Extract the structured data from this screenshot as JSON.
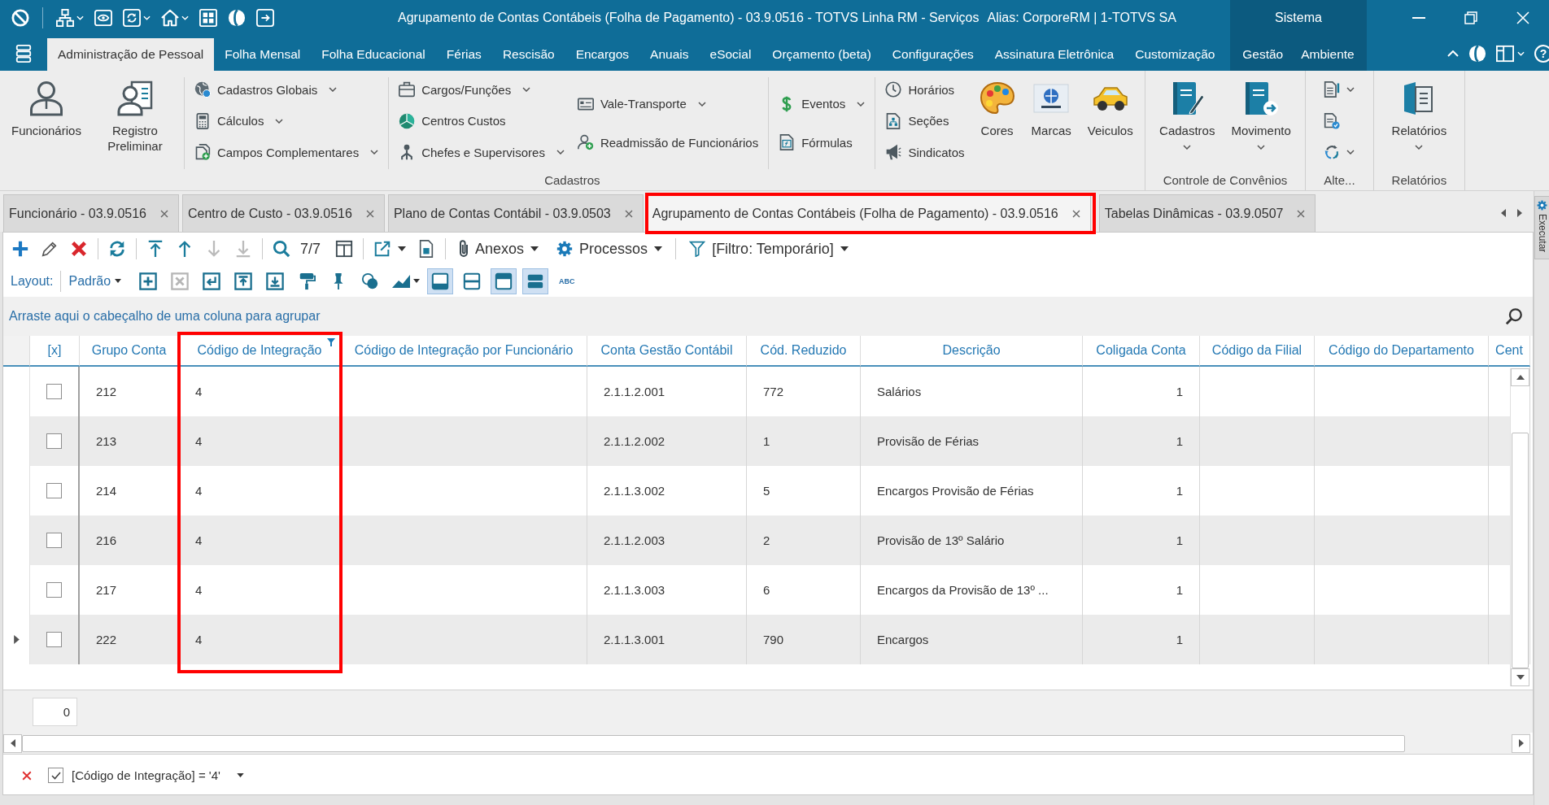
{
  "window": {
    "title": "Agrupamento de Contas Contábeis (Folha de Pagamento) - 03.9.0516 - TOTVS Linha RM - Serviços",
    "alias": "Alias: CorporeRM | 1-TOTVS SA",
    "context_group": "Sistema"
  },
  "menu": {
    "tabs": [
      {
        "label": "Administração de Pessoal",
        "selected": true
      },
      {
        "label": "Folha Mensal",
        "selected": false
      },
      {
        "label": "Folha Educacional",
        "selected": false
      },
      {
        "label": "Férias",
        "selected": false
      },
      {
        "label": "Rescisão",
        "selected": false
      },
      {
        "label": "Encargos",
        "selected": false
      },
      {
        "label": "Anuais",
        "selected": false
      },
      {
        "label": "eSocial",
        "selected": false
      },
      {
        "label": "Orçamento (beta)",
        "selected": false
      },
      {
        "label": "Configurações",
        "selected": false
      },
      {
        "label": "Assinatura Eletrônica",
        "selected": false
      },
      {
        "label": "Customização",
        "selected": false
      }
    ],
    "context_tabs": [
      {
        "label": "Gestão",
        "selected": false
      },
      {
        "label": "Ambiente",
        "selected": false
      }
    ],
    "help": "?"
  },
  "ribbon": {
    "groups": [
      {
        "label": "Cadastros",
        "sections": [
          {
            "blocks": [
              {
                "kind": "large",
                "items": [
                  {
                    "label": "Funcionários",
                    "dropdown": false
                  },
                  {
                    "label": "Registro Preliminar",
                    "dropdown": false
                  }
                ]
              }
            ]
          },
          {
            "blocks": [
              {
                "kind": "column",
                "items": [
                  {
                    "label": "Cadastros Globais",
                    "dropdown": true
                  },
                  {
                    "label": "Cálculos",
                    "dropdown": true
                  },
                  {
                    "label": "Campos Complementares",
                    "dropdown": true
                  }
                ]
              }
            ]
          },
          {
            "blocks": [
              {
                "kind": "column",
                "items": [
                  {
                    "label": "Cargos/Funções",
                    "dropdown": true
                  },
                  {
                    "label": "Centros Custos",
                    "dropdown": false
                  },
                  {
                    "label": "Chefes e Supervisores",
                    "dropdown": true
                  }
                ]
              },
              {
                "kind": "column",
                "items": [
                  {
                    "label": "Vale-Transporte",
                    "dropdown": true
                  },
                  {
                    "label": "Readmissão de Funcionários",
                    "dropdown": false
                  }
                ]
              }
            ]
          },
          {
            "blocks": [
              {
                "kind": "column",
                "items": [
                  {
                    "label": "Eventos",
                    "dropdown": true
                  },
                  {
                    "label": "Fórmulas",
                    "dropdown": false
                  }
                ]
              }
            ]
          },
          {
            "blocks": [
              {
                "kind": "column",
                "items": [
                  {
                    "label": "Horários",
                    "dropdown": false
                  },
                  {
                    "label": "Seções",
                    "dropdown": false
                  },
                  {
                    "label": "Sindicatos",
                    "dropdown": false
                  }
                ]
              },
              {
                "kind": "large",
                "items": [
                  {
                    "label": "Cores",
                    "dropdown": false
                  },
                  {
                    "label": "Marcas",
                    "dropdown": false
                  },
                  {
                    "label": "Veiculos",
                    "dropdown": false
                  }
                ]
              }
            ]
          }
        ]
      },
      {
        "label": "Controle de Convênios",
        "sections": [
          {
            "blocks": [
              {
                "kind": "large",
                "items": [
                  {
                    "label": "Cadastros",
                    "dropdown": true
                  },
                  {
                    "label": "Movimento",
                    "dropdown": true
                  }
                ]
              }
            ]
          }
        ]
      },
      {
        "label": "Alte...",
        "sections": [
          {
            "blocks": [
              {
                "kind": "icons",
                "items": [
                  {
                    "dropdown": true
                  },
                  {
                    "dropdown": false
                  },
                  {
                    "dropdown": true
                  }
                ]
              }
            ]
          }
        ]
      },
      {
        "label": "Relatórios",
        "sections": [
          {
            "blocks": [
              {
                "kind": "large",
                "items": [
                  {
                    "label": "Relatórios",
                    "dropdown": true
                  }
                ]
              }
            ]
          }
        ]
      }
    ]
  },
  "documents": {
    "tabs": [
      {
        "label": "Funcionário - 03.9.0516",
        "selected": false,
        "highlighted": false
      },
      {
        "label": "Centro de Custo - 03.9.0516",
        "selected": false,
        "highlighted": false
      },
      {
        "label": "Plano de Contas Contábil - 03.9.0503",
        "selected": false,
        "highlighted": false
      },
      {
        "label": "Agrupamento de Contas Contábeis (Folha de Pagamento) - 03.9.0516",
        "selected": true,
        "highlighted": true
      },
      {
        "label": "Tabelas Dinâmicas - 03.9.0507",
        "selected": false,
        "highlighted": false
      }
    ]
  },
  "toolbar": {
    "groups": [
      {
        "items": [
          {
            "kind": "button",
            "disabled": false
          },
          {
            "kind": "button",
            "disabled": false
          },
          {
            "kind": "button",
            "disabled": false
          }
        ]
      },
      {
        "items": [
          {
            "kind": "button",
            "disabled": false
          }
        ]
      },
      {
        "items": [
          {
            "kind": "button",
            "disabled": false
          },
          {
            "kind": "button",
            "disabled": false
          },
          {
            "kind": "button",
            "disabled": true
          },
          {
            "kind": "button",
            "disabled": true
          }
        ]
      },
      {
        "items": [
          {
            "kind": "button",
            "disabled": false
          },
          {
            "kind": "text",
            "label": "7/7"
          },
          {
            "kind": "button",
            "disabled": false
          }
        ]
      },
      {
        "items": [
          {
            "kind": "dropdown",
            "disabled": false
          },
          {
            "kind": "button",
            "disabled": false
          }
        ]
      },
      {
        "items": [
          {
            "kind": "menu",
            "label": "Anexos",
            "disabled": false
          },
          {
            "kind": "menu",
            "label": "Processos",
            "disabled": false
          }
        ]
      },
      {
        "items": [
          {
            "kind": "menu",
            "label": "[Filtro: Temporário]",
            "disabled": false
          }
        ]
      }
    ]
  },
  "layout_bar": {
    "label": "Layout:",
    "menu": "Padrão",
    "items": [
      {
        "kind": "button",
        "disabled": false
      },
      {
        "kind": "button",
        "disabled": true
      },
      {
        "kind": "button",
        "disabled": false
      },
      {
        "kind": "button",
        "disabled": false
      },
      {
        "kind": "button",
        "disabled": false
      },
      {
        "kind": "button",
        "disabled": false
      },
      {
        "kind": "button",
        "disabled": false
      },
      {
        "kind": "button",
        "disabled": false
      },
      {
        "kind": "dropdown",
        "disabled": false
      },
      {
        "kind": "toggle",
        "pressed": true
      },
      {
        "kind": "toggle",
        "pressed": false
      },
      {
        "kind": "toggle",
        "pressed": true
      },
      {
        "kind": "toggle",
        "pressed": true
      },
      {
        "kind": "text",
        "label": "ABC"
      }
    ]
  },
  "table": {
    "group_hint": "Arraste aqui o cabeçalho de uma coluna para agrupar",
    "columns": [
      {
        "label": "[x]",
        "kind": "check",
        "filtered": false,
        "highlighted": false
      },
      {
        "label": "Grupo Conta",
        "kind": "text",
        "filtered": false,
        "highlighted": false
      },
      {
        "label": "Código de Integração",
        "kind": "text",
        "filtered": true,
        "highlighted": true
      },
      {
        "label": "Código de Integração por Funcionário",
        "kind": "text",
        "filtered": false,
        "highlighted": false
      },
      {
        "label": "Conta Gestão Contábil",
        "kind": "text",
        "filtered": false,
        "highlighted": false
      },
      {
        "label": "Cód. Reduzido",
        "kind": "text",
        "filtered": false,
        "highlighted": false
      },
      {
        "label": "Descrição",
        "kind": "text",
        "filtered": false,
        "highlighted": false
      },
      {
        "label": "Coligada Conta",
        "kind": "number",
        "filtered": false,
        "highlighted": false
      },
      {
        "label": "Código da Filial",
        "kind": "text",
        "filtered": false,
        "highlighted": false
      },
      {
        "label": "Código do Departamento",
        "kind": "text",
        "filtered": false,
        "highlighted": false
      },
      {
        "label": "Cent",
        "kind": "text",
        "filtered": false,
        "highlighted": false
      }
    ],
    "rows": [
      {
        "current": false,
        "checked": false,
        "cells": [
          null,
          "212",
          "4",
          null,
          "2.1.1.2.001",
          "772",
          "Salários",
          "1",
          null,
          null,
          null
        ]
      },
      {
        "current": false,
        "checked": false,
        "cells": [
          null,
          "213",
          "4",
          null,
          "2.1.1.2.002",
          "1",
          "Provisão de Férias",
          "1",
          null,
          null,
          null
        ]
      },
      {
        "current": false,
        "checked": false,
        "cells": [
          null,
          "214",
          "4",
          null,
          "2.1.1.3.002",
          "5",
          "Encargos Provisão de Férias",
          "1",
          null,
          null,
          null
        ]
      },
      {
        "current": false,
        "checked": false,
        "cells": [
          null,
          "216",
          "4",
          null,
          "2.1.1.2.003",
          "2",
          "Provisão de 13º Salário",
          "1",
          null,
          null,
          null
        ]
      },
      {
        "current": false,
        "checked": false,
        "cells": [
          null,
          "217",
          "4",
          null,
          "2.1.1.3.003",
          "6",
          "Encargos da Provisão de 13º ...",
          "1",
          null,
          null,
          null
        ]
      },
      {
        "current": true,
        "checked": false,
        "cells": [
          null,
          "222",
          "4",
          null,
          "2.1.1.3.001",
          "790",
          "Encargos",
          "1",
          null,
          null,
          null
        ]
      }
    ],
    "summary": "0"
  },
  "filter_bar": {
    "checked": true,
    "expression": "[Código de Integração] = '4'"
  },
  "side_panel": {
    "tab": "Executar"
  }
}
